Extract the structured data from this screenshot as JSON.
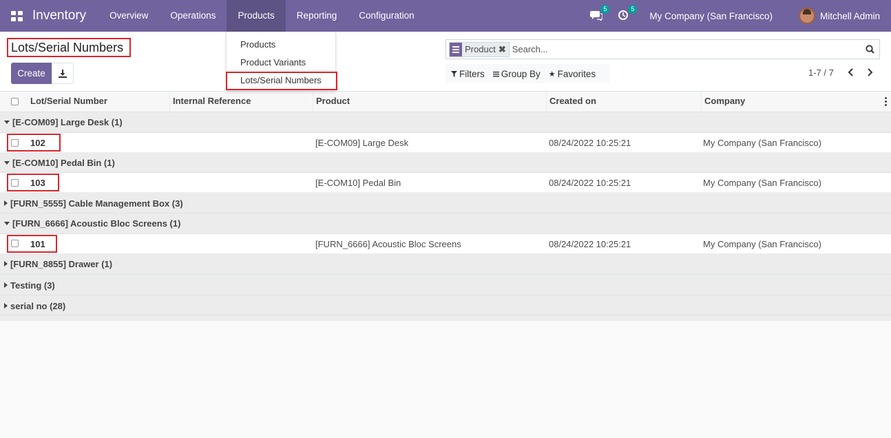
{
  "navbar": {
    "app_name": "Inventory",
    "menu": [
      "Overview",
      "Operations",
      "Products",
      "Reporting",
      "Configuration"
    ],
    "messages_badge": "5",
    "activities_badge": "5",
    "company": "My Company (San Francisco)",
    "user": "Mitchell Admin"
  },
  "products_dropdown": {
    "items": [
      "Products",
      "Product Variants",
      "Lots/Serial Numbers"
    ]
  },
  "control_panel": {
    "title": "Lots/Serial Numbers",
    "create_label": "Create",
    "search_facet": "Product",
    "search_placeholder": "Search...",
    "filters_label": "Filters",
    "group_by_label": "Group By",
    "favorites_label": "Favorites",
    "pager": "1-7 / 7"
  },
  "table": {
    "columns": [
      "Lot/Serial Number",
      "Internal Reference",
      "Product",
      "Created on",
      "Company"
    ],
    "groups": [
      {
        "label": "[E-COM09] Large Desk (1)",
        "expanded": true,
        "rows": [
          {
            "lot": "102",
            "ref": "",
            "product": "[E-COM09] Large Desk",
            "created": "08/24/2022 10:25:21",
            "company": "My Company (San Francisco)"
          }
        ]
      },
      {
        "label": "[E-COM10] Pedal Bin (1)",
        "expanded": true,
        "rows": [
          {
            "lot": "103",
            "ref": "",
            "product": "[E-COM10] Pedal Bin",
            "created": "08/24/2022 10:25:21",
            "company": "My Company (San Francisco)"
          }
        ]
      },
      {
        "label": "[FURN_5555] Cable Management Box (3)",
        "expanded": false,
        "rows": []
      },
      {
        "label": "[FURN_6666] Acoustic Bloc Screens (1)",
        "expanded": true,
        "rows": [
          {
            "lot": "101",
            "ref": "",
            "product": "[FURN_6666] Acoustic Bloc Screens",
            "created": "08/24/2022 10:25:21",
            "company": "My Company (San Francisco)"
          }
        ]
      },
      {
        "label": "[FURN_8855] Drawer (1)",
        "expanded": false,
        "rows": []
      },
      {
        "label": "Testing (3)",
        "expanded": false,
        "rows": []
      },
      {
        "label": "serial no (28)",
        "expanded": false,
        "rows": []
      }
    ]
  },
  "colors": {
    "brand": "#71639e",
    "highlight": "#d9262d",
    "badge": "#00a09d"
  }
}
